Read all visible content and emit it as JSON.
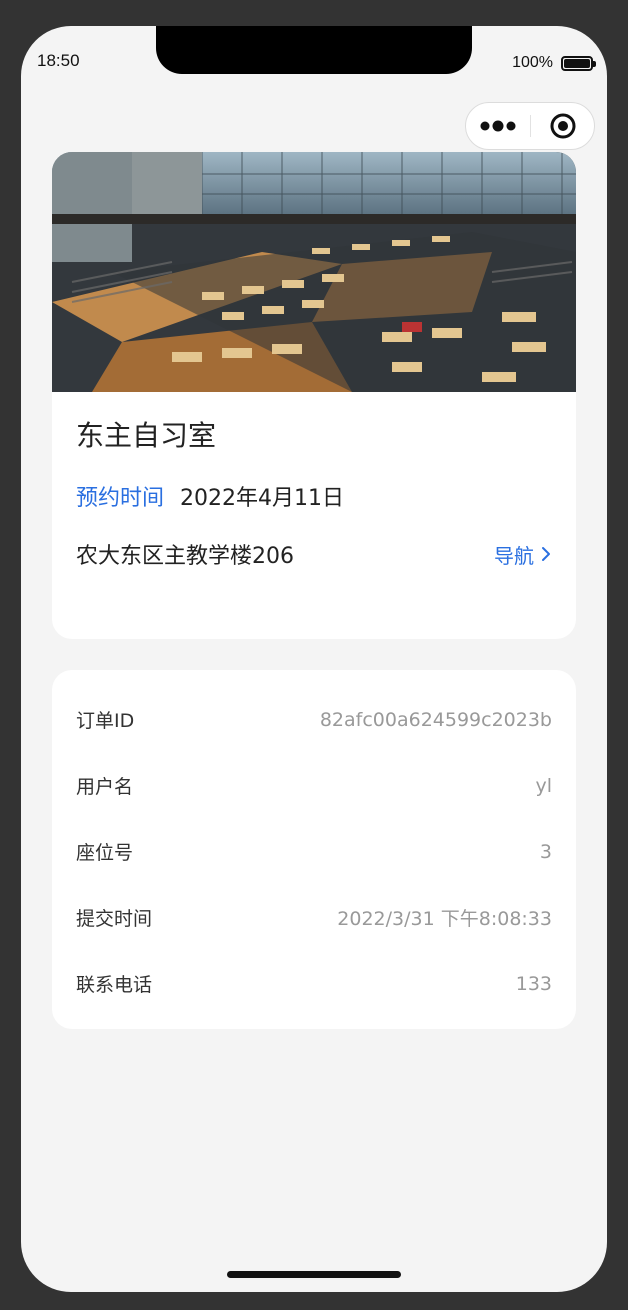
{
  "status_bar": {
    "time": "18:50",
    "battery": "100%"
  },
  "capsule": {
    "more_icon": "more-dots-icon",
    "close_icon": "target-circle-icon"
  },
  "venue": {
    "photo": "library-reading-room-photo",
    "name": "东主自习室",
    "reservation_label": "预约时间",
    "reservation_date": "2022年4月11日",
    "address": "农大东区主教学楼206",
    "navigate_label": "导航",
    "accent_color": "#2a6fe0"
  },
  "order": {
    "rows": [
      {
        "label": "订单ID",
        "value": "82afc00a624599c2023b"
      },
      {
        "label": "用户名",
        "value": "yl"
      },
      {
        "label": "座位号",
        "value": "3"
      },
      {
        "label": "提交时间",
        "value": "2022/3/31 下午8:08:33"
      },
      {
        "label": "联系电话",
        "value": "133"
      }
    ]
  }
}
